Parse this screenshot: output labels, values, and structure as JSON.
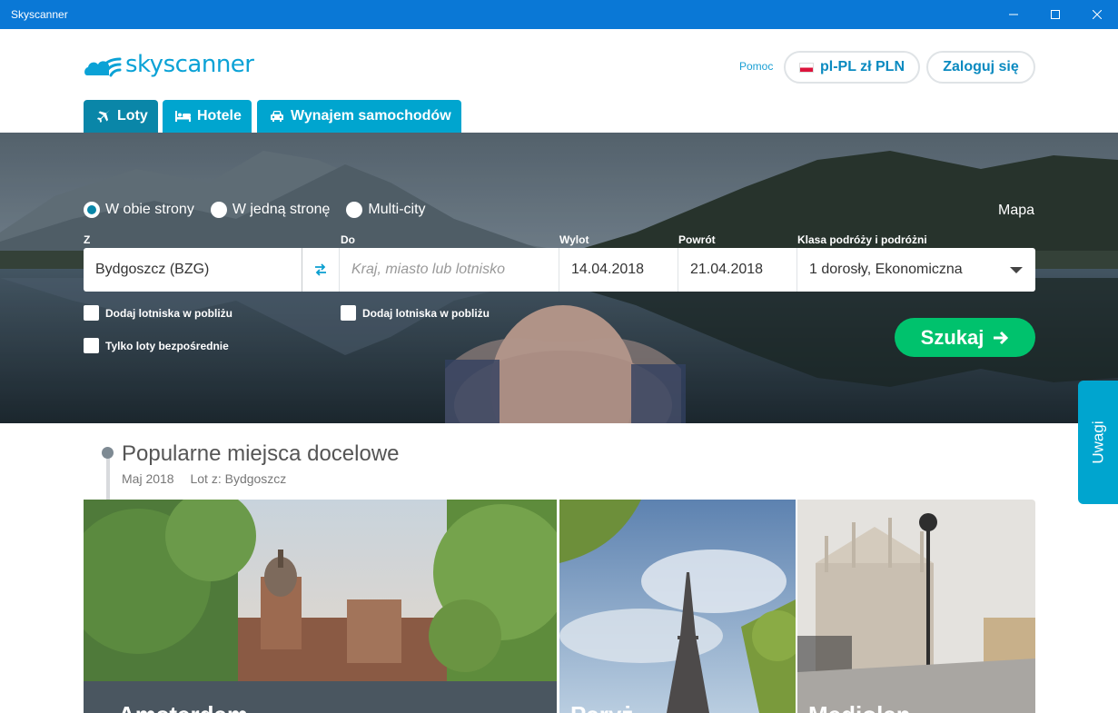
{
  "window": {
    "title": "Skyscanner"
  },
  "header": {
    "logo_text": "skyscanner",
    "help": "Pomoc",
    "locale": "pl-PL zł PLN",
    "login": "Zaloguj się"
  },
  "tabs": [
    {
      "label": "Loty",
      "icon": "plane-icon",
      "active": true
    },
    {
      "label": "Hotele",
      "icon": "bed-icon",
      "active": false
    },
    {
      "label": "Wynajem samochodów",
      "icon": "car-icon",
      "active": false
    }
  ],
  "search": {
    "trip_types": [
      {
        "label": "W obie strony",
        "checked": true
      },
      {
        "label": "W jedną stronę",
        "checked": false
      },
      {
        "label": "Multi-city",
        "checked": false
      }
    ],
    "map_link": "Mapa",
    "labels": {
      "from": "Z",
      "to": "Do",
      "depart": "Wylot",
      "return": "Powrót",
      "cabin": "Klasa podróży i podróżni"
    },
    "from_value": "Bydgoszcz (BZG)",
    "to_placeholder": "Kraj, miasto lub lotnisko",
    "depart_value": "14.04.2018",
    "return_value": "21.04.2018",
    "cabin_value": "1 dorosły, Ekonomiczna",
    "nearby_from": "Dodaj lotniska w pobliżu",
    "nearby_to": "Dodaj lotniska w pobliżu",
    "direct_only": "Tylko loty bezpośrednie",
    "submit": "Szukaj"
  },
  "feedback": "Uwagi",
  "popular": {
    "title": "Popularne miejsca docelowe",
    "month": "Maj 2018",
    "from_label": "Lot z: Bydgoszcz",
    "cards": [
      {
        "city": "Amsterdam"
      },
      {
        "city": "Paryż"
      },
      {
        "city": "Mediolan"
      }
    ]
  },
  "colors": {
    "titlebar": "#0a78d6",
    "brand": "#00a5cf",
    "tab_active": "#0a86a8",
    "search_button": "#00c26d"
  }
}
